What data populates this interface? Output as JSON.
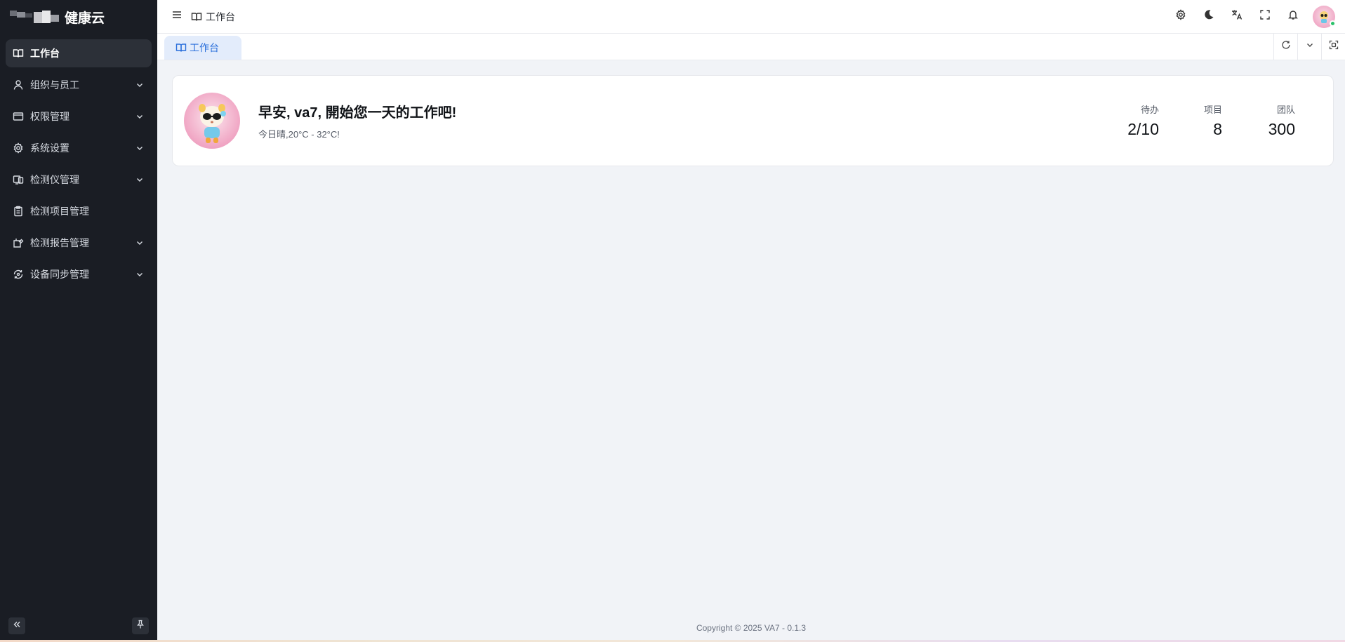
{
  "sidebar": {
    "logo_text": "健康云",
    "items": [
      {
        "label": "工作台",
        "icon": "book-open-icon",
        "active": true,
        "has_children": false
      },
      {
        "label": "组织与员工",
        "icon": "user-icon",
        "has_children": true
      },
      {
        "label": "权限管理",
        "icon": "window-icon",
        "has_children": true
      },
      {
        "label": "系统设置",
        "icon": "gear-icon",
        "has_children": true
      },
      {
        "label": "检测仪管理",
        "icon": "device-icon",
        "has_children": true
      },
      {
        "label": "检测项目管理",
        "icon": "clipboard-icon",
        "has_children": false
      },
      {
        "label": "检测报告管理",
        "icon": "report-icon",
        "has_children": true
      },
      {
        "label": "设备同步管理",
        "icon": "sync-icon",
        "has_children": true
      }
    ]
  },
  "header": {
    "breadcrumb": "工作台"
  },
  "tabs": [
    {
      "label": "工作台",
      "active": true
    }
  ],
  "welcome": {
    "title": "早安, va7, 開始您一天的工作吧!",
    "subtitle": "今日晴,20°C - 32°C!"
  },
  "stats": [
    {
      "label": "待办",
      "value": "2/10"
    },
    {
      "label": "项目",
      "value": "8"
    },
    {
      "label": "团队",
      "value": "300"
    }
  ],
  "footer": {
    "copyright": "Copyright © 2025 VA7 - 0.1.3"
  },
  "colors": {
    "sidebar_bg": "#1a1d24",
    "accent": "#2a6fdb",
    "online": "#2bc26a"
  }
}
